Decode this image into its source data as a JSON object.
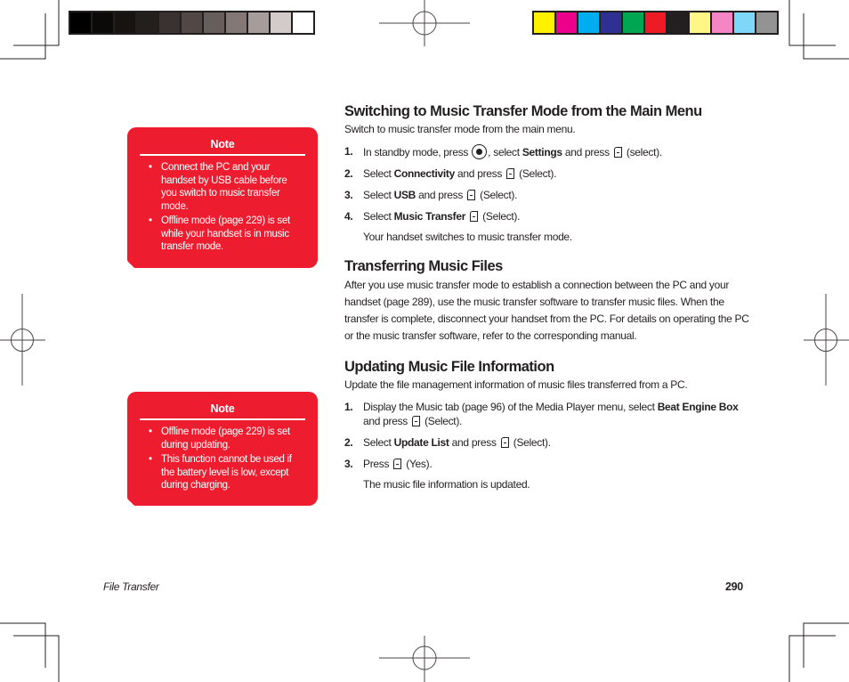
{
  "print_marks": {
    "gray_swatches": [
      "#000000",
      "#0b0a09",
      "#171311",
      "#231f1d",
      "#3a3230",
      "#514745",
      "#675d5a",
      "#837875",
      "#a69d9b",
      "#d3cbca",
      "#ffffff"
    ],
    "color_swatches": [
      "#fff100",
      "#ec008c",
      "#00aeef",
      "#2e3192",
      "#00a651",
      "#ed1c24",
      "#231f20",
      "#fff685",
      "#f485c4",
      "#7fd7f7",
      "#939393"
    ]
  },
  "notes": [
    {
      "title": "Note",
      "bullet": "•",
      "items": [
        "Connect the PC and your handset by USB cable before you switch to music transfer mode.",
        "Offline mode (page 229) is set while your handset is in music transfer mode."
      ]
    },
    {
      "title": "Note",
      "bullet": "•",
      "items": [
        "Offline mode (page 229) is set during updating.",
        "This function cannot be used if the battery level is low, except during charging."
      ]
    }
  ],
  "sections": {
    "switching": {
      "heading": "Switching to Music Transfer Mode from the Main Menu",
      "intro": "Switch to music transfer mode from the main menu.",
      "steps": [
        {
          "num": "1.",
          "a": "In standby mode, press ",
          "icon": "center-key-icon",
          "b": ", select ",
          "bold": "Settings",
          "c": " and press ",
          "d": " (select)."
        },
        {
          "num": "2.",
          "a": "Select ",
          "bold": "Connectivity",
          "b": " and press ",
          "c": " (Select)."
        },
        {
          "num": "3.",
          "a": "Select ",
          "bold": "USB",
          "b": " and press ",
          "c": " (Select)."
        },
        {
          "num": "4.",
          "a": "Select ",
          "bold": "Music Transfer",
          "b": " ",
          "c": " (Select)."
        }
      ],
      "result": "Your handset switches to music transfer mode."
    },
    "transferring": {
      "heading": "Transferring Music Files",
      "body": "After you use music transfer mode to establish a connection between the PC and your handset (page 289), use the music transfer software to transfer music files. When the transfer is complete, disconnect your handset from the PC. For details on operating the PC or the music transfer software, refer to the corresponding manual."
    },
    "updating": {
      "heading": "Updating Music File Information",
      "intro": "Update the file management information of music files transferred from a PC.",
      "steps": [
        {
          "num": "1.",
          "a": "Display the Music tab (page 96) of the Media Player menu, select ",
          "bold": "Beat Engine Box",
          "b": " and press ",
          "c": " (Select)."
        },
        {
          "num": "2.",
          "a": "Select ",
          "bold": "Update List",
          "b": " and press ",
          "c": " (Select)."
        },
        {
          "num": "3.",
          "a": "Press ",
          "c": " (Yes)."
        }
      ],
      "result": "The music file information is updated."
    }
  },
  "footer": {
    "section_name": "File Transfer",
    "page_number": "290"
  }
}
